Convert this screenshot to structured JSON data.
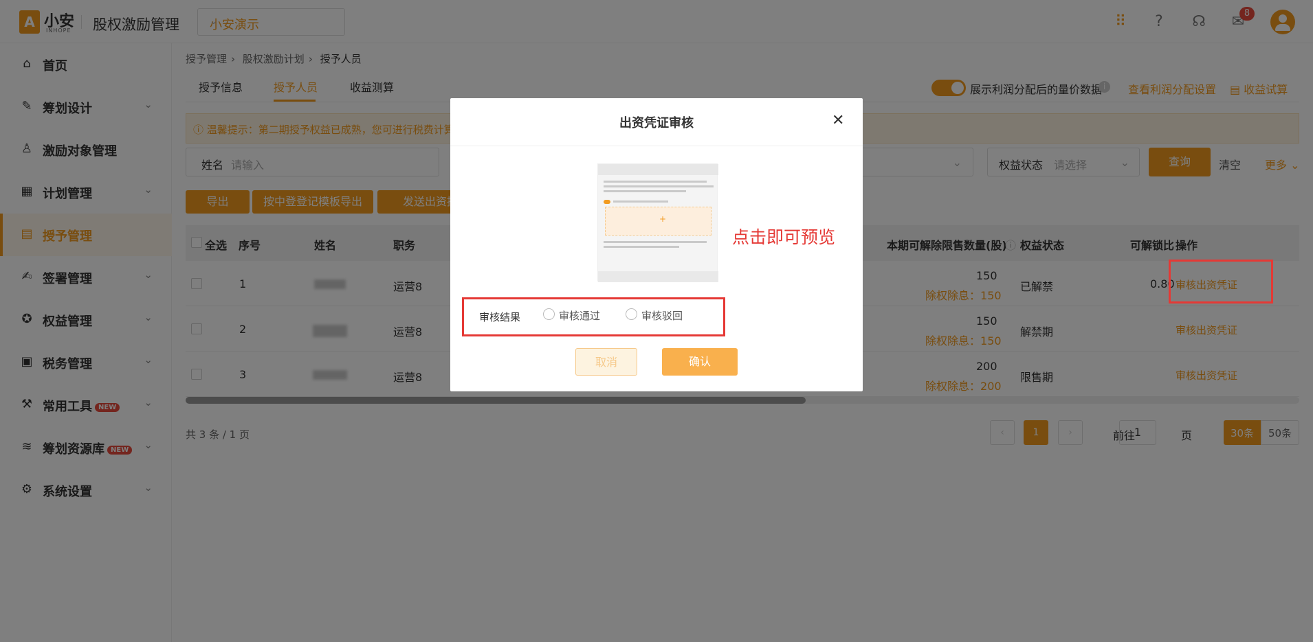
{
  "header": {
    "logo_glyph": "A",
    "logo_text": "小安",
    "logo_sub": "INHOPE",
    "app_title": "股权激励管理",
    "company": "小安演示",
    "notification_count": "8"
  },
  "sidebar": {
    "items": [
      {
        "label": "首页",
        "icon": "home-icon"
      },
      {
        "label": "筹划设计",
        "icon": "edit-icon"
      },
      {
        "label": "激励对象管理",
        "icon": "users-icon"
      },
      {
        "label": "计划管理",
        "icon": "grid-icon"
      },
      {
        "label": "授予管理",
        "icon": "doc-icon"
      },
      {
        "label": "签署管理",
        "icon": "sign-icon"
      },
      {
        "label": "权益管理",
        "icon": "badge-icon"
      },
      {
        "label": "税务管理",
        "icon": "tax-icon"
      },
      {
        "label": "常用工具",
        "icon": "toolbox-icon",
        "badge": "NEW"
      },
      {
        "label": "筹划资源库",
        "icon": "layers-icon",
        "badge": "NEW"
      },
      {
        "label": "系统设置",
        "icon": "settings-icon"
      }
    ]
  },
  "breadcrumb": [
    "授予管理",
    "股权激励计划",
    "授予人员"
  ],
  "tabs": [
    "授予信息",
    "授予人员",
    "收益测算"
  ],
  "toolbar_right": {
    "toggle_label": "展示利润分配后的量价数据",
    "link1": "查看利润分配设置",
    "link2": "收益试算"
  },
  "tip": "ⓘ 温馨提示：第二期授予权益已成熟，您可进行税费计算",
  "filters": {
    "name_label": "姓名",
    "name_placeholder": "请输入",
    "status_label": "权益状态",
    "status_placeholder": "请选择",
    "query": "查询",
    "clear": "清空",
    "more": "更多"
  },
  "actions": [
    "导出",
    "按中登登记模板导出",
    "发送出资提醒"
  ],
  "table": {
    "headers": [
      "全选",
      "序号",
      "姓名",
      "职务",
      "本期可解除限售数量(股)",
      "权益状态",
      "可解锁比",
      "操作"
    ],
    "rows": [
      {
        "index": "1",
        "position": "运营8",
        "qty": "150",
        "ex_label": "除权除息：",
        "ex_val": "150",
        "status": "已解禁",
        "ratio": "0.80",
        "op": "审核出资凭证"
      },
      {
        "index": "2",
        "position": "运营8",
        "qty": "150",
        "ex_label": "除权除息：",
        "ex_val": "150",
        "status": "解禁期",
        "ratio": "",
        "op": "审核出资凭证"
      },
      {
        "index": "3",
        "position": "运营8",
        "qty": "200",
        "ex_label": "除权除息：",
        "ex_val": "200",
        "status": "限售期",
        "ratio": "",
        "op": "审核出资凭证"
      }
    ]
  },
  "pagination": {
    "total": "共 3 条 / 1 页",
    "current": "1",
    "goto_label": "前往",
    "goto_value": "1",
    "page_unit": "页",
    "size_30": "30条",
    "size_50": "50条"
  },
  "modal": {
    "title": "出资凭证审核",
    "preview_hint": "点击即可预览",
    "result_label": "审核结果",
    "option_pass": "审核通过",
    "option_reject": "审核驳回",
    "cancel": "取消",
    "confirm": "确认"
  },
  "colors": {
    "accent": "#f29b1f",
    "danger": "#e53935"
  }
}
